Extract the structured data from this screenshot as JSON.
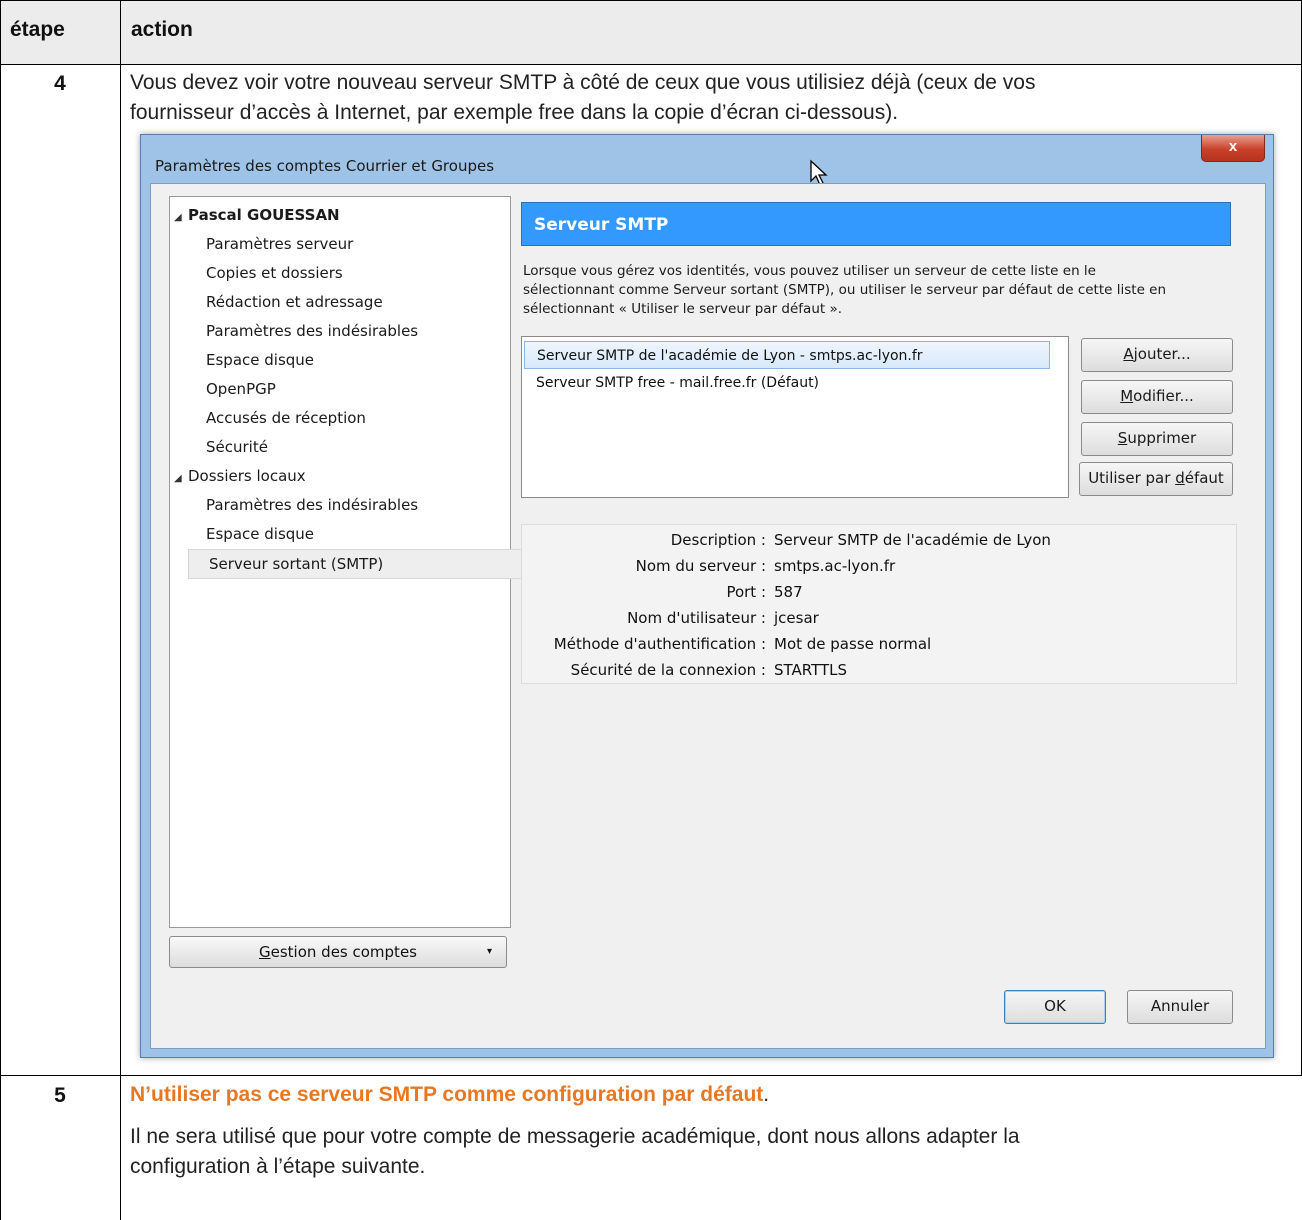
{
  "table": {
    "col_step": "étape",
    "col_action": "action"
  },
  "row4": {
    "step": "4",
    "line1": "Vous devez voir votre nouveau serveur SMTP à côté de ceux que vous utilisiez déjà (ceux de vos",
    "line2": "fournisseur d’accès à Internet, par exemple free dans la copie d’écran ci-dessous)."
  },
  "dialog": {
    "title": "Paramètres des comptes Courrier et Groupes",
    "close_label": "x",
    "tree": [
      {
        "label": "Pascal GOUESSAN",
        "level": 0,
        "expanded": true,
        "bold": true
      },
      {
        "label": "Paramètres serveur",
        "level": 1
      },
      {
        "label": "Copies et dossiers",
        "level": 1
      },
      {
        "label": "Rédaction et adressage",
        "level": 1
      },
      {
        "label": "Paramètres des indésirables",
        "level": 1
      },
      {
        "label": "Espace disque",
        "level": 1
      },
      {
        "label": "OpenPGP",
        "level": 1
      },
      {
        "label": "Accusés de réception",
        "level": 1
      },
      {
        "label": "Sécurité",
        "level": 1
      },
      {
        "label": "Dossiers locaux",
        "level": 0,
        "expanded": true
      },
      {
        "label": "Paramètres des indésirables",
        "level": 1
      },
      {
        "label": "Espace disque",
        "level": 1
      },
      {
        "label": "Serveur sortant (SMTP)",
        "level": 0,
        "selected": true
      }
    ],
    "gestion_first": "G",
    "gestion_rest": "estion des comptes",
    "panel_title": "Serveur SMTP",
    "description": [
      "Lorsque vous gérez vos identités, vous pouvez utiliser un serveur de cette liste en le",
      "sélectionnant comme Serveur sortant (SMTP), ou utiliser le serveur par défaut de cette liste en",
      "sélectionnant « Utiliser le serveur par défaut »."
    ],
    "servers": [
      "Serveur SMTP de l'académie de Lyon - smtps.ac-lyon.fr",
      "Serveur SMTP free - mail.free.fr (Défaut)"
    ],
    "buttons": {
      "add": {
        "u": "A",
        "rest": "jouter..."
      },
      "edit": {
        "u": "M",
        "rest": "odifier..."
      },
      "delete": {
        "u": "S",
        "rest": "upprimer"
      },
      "default_pre": "Utiliser par ",
      "default_u": "d",
      "default_rest": "éfaut"
    },
    "details": [
      {
        "label": "Description :",
        "value": "Serveur SMTP de l'académie de Lyon"
      },
      {
        "label": "Nom du serveur :",
        "value": "smtps.ac-lyon.fr"
      },
      {
        "label": "Port :",
        "value": "587"
      },
      {
        "label": "Nom d'utilisateur :",
        "value": "jcesar"
      },
      {
        "label": "Méthode d'authentification :",
        "value": "Mot de passe normal"
      },
      {
        "label": "Sécurité de la connexion :",
        "value": "STARTTLS"
      }
    ],
    "ok": "OK",
    "cancel": "Annuler"
  },
  "row5": {
    "step": "5",
    "highlight": "N’utiliser pas ce serveur SMTP comme configuration par défaut",
    "highlight_end": ".",
    "line1": "Il ne sera utilisé que pour votre compte de messagerie académique, dont nous allons adapter la",
    "line2": "configuration à l’étape suivante."
  },
  "colors": {
    "highlight": "#e87722",
    "panel_header": "#3399ff"
  }
}
